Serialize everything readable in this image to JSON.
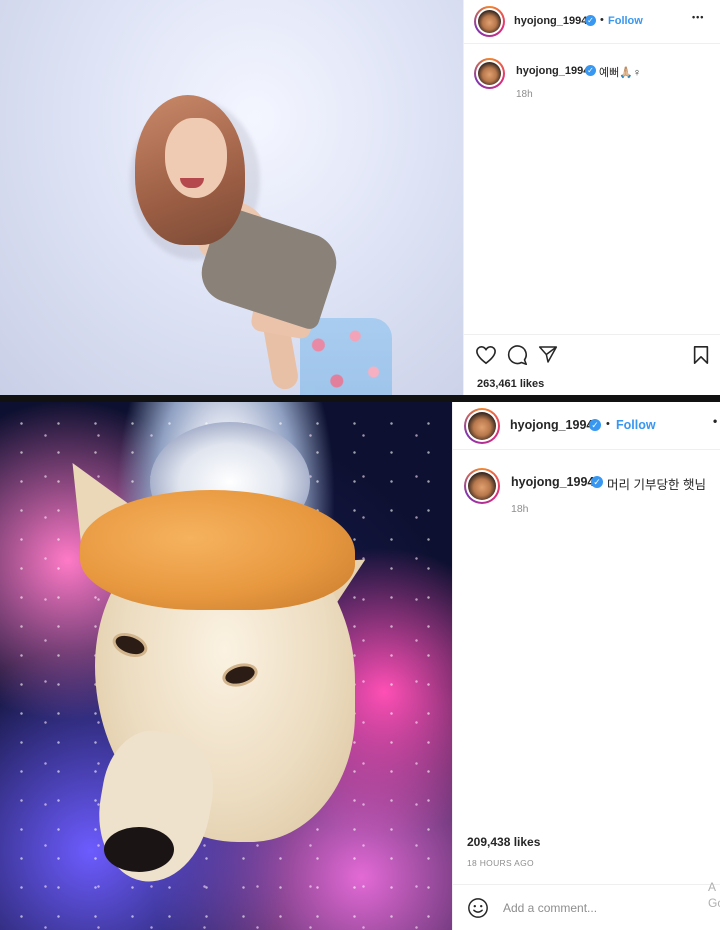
{
  "post1": {
    "username": "hyojong_1994",
    "follow_label": "Follow",
    "dot": "•",
    "more": "•••",
    "caption_user": "hyojong_1994",
    "caption_text": "예뻐🙏🏼♀",
    "time": "18h",
    "likes": "263,461 likes"
  },
  "post2": {
    "username": "hyojong_1994",
    "follow_label": "Follow",
    "dot": "•",
    "caption_user": "hyojong_1994",
    "caption_text": "머리 기부당한 햇님",
    "time": "18h",
    "likes": "209,438 likes",
    "ago": "18 HOURS AGO",
    "comment_placeholder": "Add a comment...",
    "overflow_text": "A Go"
  },
  "icons": [
    "heart-icon",
    "comment-icon",
    "share-icon",
    "bookmark-icon",
    "verified-icon",
    "emoji-icon",
    "more-icon"
  ],
  "colors": {
    "accent": "#3897f0",
    "text": "#262626",
    "muted": "#8e8e8e",
    "border": "#efefef"
  }
}
